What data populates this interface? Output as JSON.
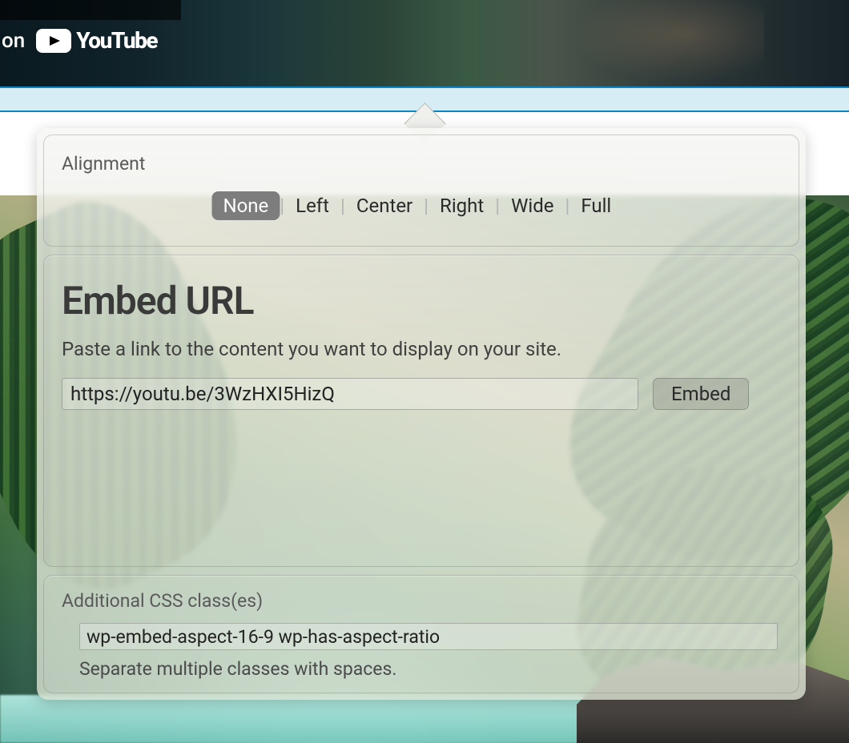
{
  "video": {
    "watch_prefix": "on",
    "brand": "YouTube"
  },
  "alignment": {
    "label": "Alignment",
    "options": [
      "None",
      "Left",
      "Center",
      "Right",
      "Wide",
      "Full"
    ],
    "selected": "None"
  },
  "embed": {
    "title": "Embed URL",
    "description": "Paste a link to the content you want to display on your site.",
    "url_value": "https://youtu.be/3WzHXI5HizQ",
    "button_label": "Embed"
  },
  "css": {
    "label": "Additional CSS class(es)",
    "value": "wp-embed-aspect-16-9 wp-has-aspect-ratio",
    "help": "Separate multiple classes with spaces."
  }
}
